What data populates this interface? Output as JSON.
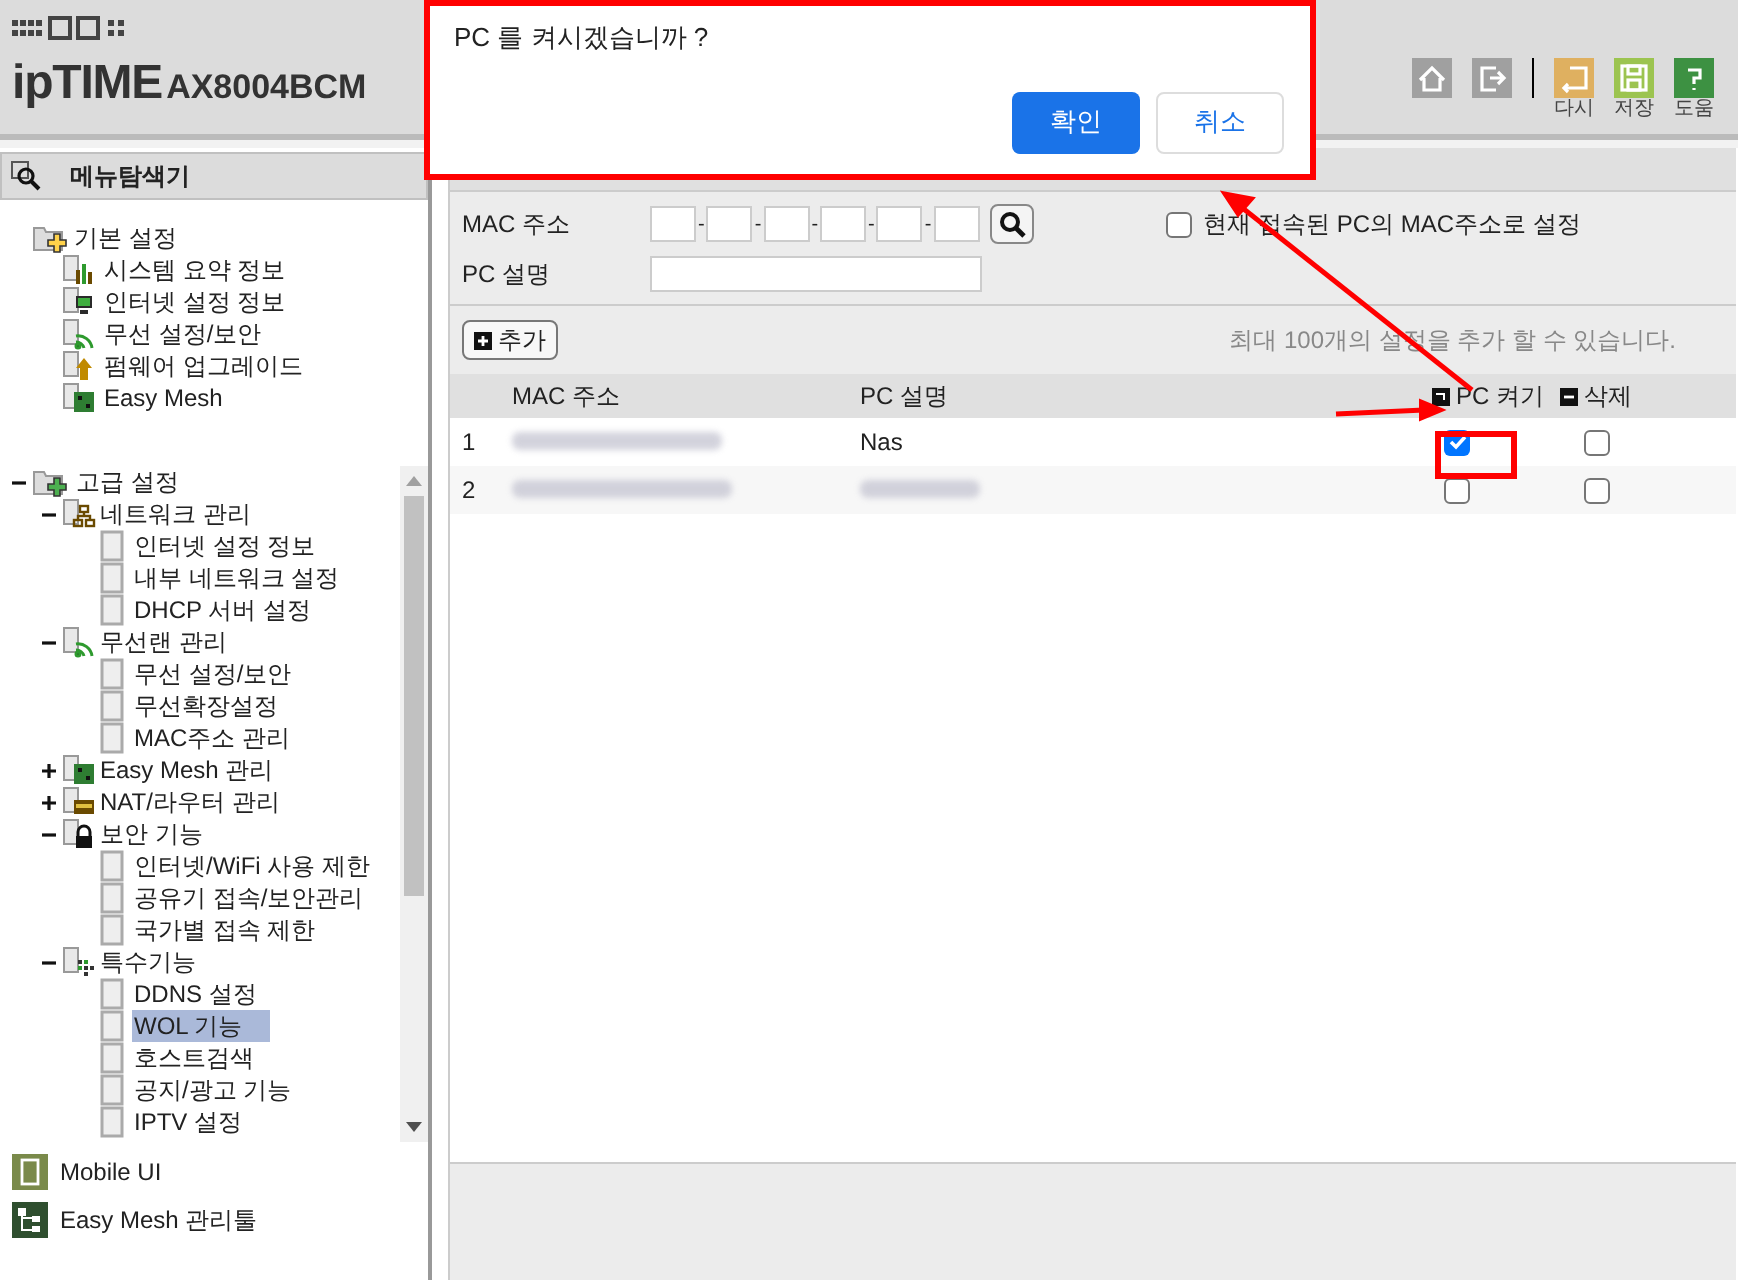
{
  "header": {
    "brand": "ipTIME",
    "model": "AX8004BCM",
    "tools": [
      {
        "kind": "home"
      },
      {
        "kind": "logout"
      },
      {
        "kind": "undo",
        "label": "다시"
      },
      {
        "kind": "save",
        "label": "저장"
      },
      {
        "kind": "help",
        "label": "도움"
      }
    ]
  },
  "sidebar": {
    "title": "메뉴탐색기",
    "basic": {
      "label": "기본 설정",
      "items": [
        {
          "label": "시스템 요약 정보",
          "kind": "chart"
        },
        {
          "label": "인터넷 설정 정보",
          "kind": "monitor"
        },
        {
          "label": "무선 설정/보안",
          "kind": "wifi"
        },
        {
          "label": "펌웨어 업그레이드",
          "kind": "upload"
        },
        {
          "label": "Easy Mesh",
          "kind": "mesh"
        }
      ]
    },
    "advanced": {
      "label": "고급 설정",
      "expanded": true,
      "children": [
        {
          "label": "네트워크 관리",
          "kind": "network",
          "expanded": true,
          "children": [
            {
              "label": "인터넷 설정 정보",
              "selected": false
            },
            {
              "label": "내부 네트워크 설정",
              "selected": false
            },
            {
              "label": "DHCP 서버 설정",
              "selected": false
            }
          ]
        },
        {
          "label": "무선랜 관리",
          "kind": "wifi",
          "expanded": true,
          "children": [
            {
              "label": "무선 설정/보안",
              "selected": false
            },
            {
              "label": "무선확장설정",
              "selected": false
            },
            {
              "label": "MAC주소 관리",
              "selected": false
            }
          ]
        },
        {
          "label": "Easy Mesh 관리",
          "kind": "mesh",
          "expanded": false
        },
        {
          "label": "NAT/라우터 관리",
          "kind": "nat",
          "expanded": false
        },
        {
          "label": "보안 기능",
          "kind": "lock",
          "expanded": true,
          "children": [
            {
              "label": "인터넷/WiFi 사용 제한",
              "selected": false
            },
            {
              "label": "공유기 접속/보안관리",
              "selected": false
            },
            {
              "label": "국가별 접속 제한",
              "selected": false
            }
          ]
        },
        {
          "label": "특수기능",
          "kind": "special",
          "expanded": true,
          "children": [
            {
              "label": "DDNS 설정",
              "selected": false
            },
            {
              "label": "WOL 기능",
              "selected": true
            },
            {
              "label": "호스트검색",
              "selected": false
            },
            {
              "label": "공지/광고 기능",
              "selected": false
            },
            {
              "label": "IPTV 설정",
              "selected": false
            }
          ]
        }
      ]
    },
    "bottom": [
      {
        "label": "Mobile UI",
        "kind": "mobile"
      },
      {
        "label": "Easy Mesh 관리툴",
        "kind": "mesh"
      }
    ]
  },
  "form": {
    "mac_label": "MAC 주소",
    "separator": "-",
    "pc_label": "PC 설명",
    "current_pc": {
      "label": "현재 접속된 PC의 MAC주소로 설정",
      "checked": false
    },
    "add_button": "추가",
    "limit_note": "최대 100개의 설정을 추가 할 수 있습니다."
  },
  "table": {
    "columns": [
      "MAC 주소",
      "PC 설명",
      "PC 켜기",
      "삭제"
    ],
    "rows": [
      {
        "index": "1",
        "description": "Nas",
        "wake": true,
        "delete": false
      },
      {
        "index": "2",
        "wake": false,
        "delete": false
      }
    ]
  },
  "dialog": {
    "message": "PC 를 켜시겠습니까 ?",
    "ok": "확인",
    "cancel": "취소"
  }
}
